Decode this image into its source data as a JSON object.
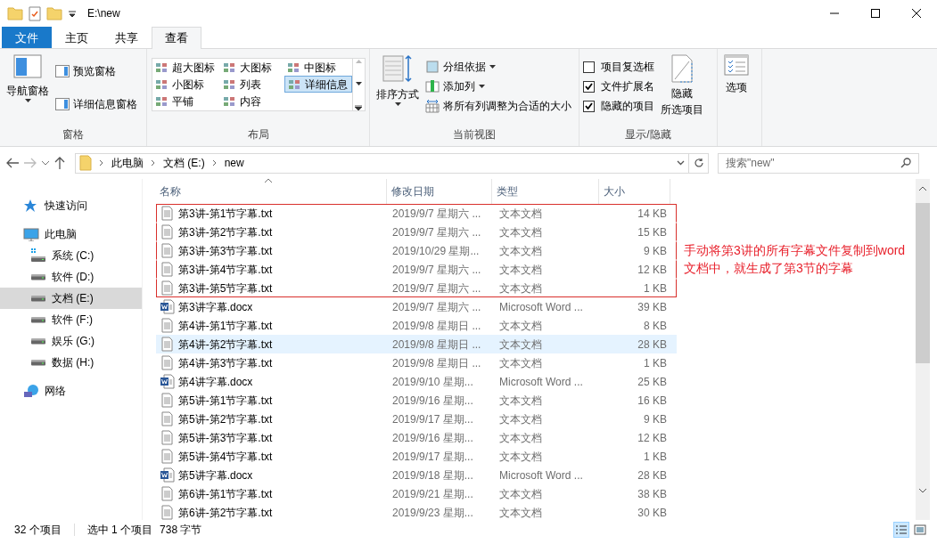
{
  "window": {
    "title": "E:\\new"
  },
  "tabs": [
    {
      "label": "文件",
      "kind": "file",
      "selected": false
    },
    {
      "label": "主页",
      "kind": "tab",
      "selected": false
    },
    {
      "label": "共享",
      "kind": "tab",
      "selected": false
    },
    {
      "label": "查看",
      "kind": "tab",
      "selected": true
    }
  ],
  "ribbon": {
    "groups": [
      {
        "kind": "panes",
        "label": "窗格",
        "large": {
          "label": "导航窗格"
        },
        "items": [
          {
            "label": "预览窗格"
          },
          {
            "label": "详细信息窗格"
          }
        ]
      },
      {
        "kind": "layout",
        "label": "布局",
        "items": [
          {
            "label": "超大图标",
            "selected": false
          },
          {
            "label": "大图标",
            "selected": false
          },
          {
            "label": "中图标",
            "selected": false
          },
          {
            "label": "小图标",
            "selected": false
          },
          {
            "label": "列表",
            "selected": false
          },
          {
            "label": "详细信息",
            "selected": true
          },
          {
            "label": "平铺",
            "selected": false
          },
          {
            "label": "内容",
            "selected": false
          }
        ]
      },
      {
        "kind": "view",
        "label": "当前视图",
        "large": {
          "label": "排序方式"
        },
        "items": [
          {
            "label": "分组依据",
            "dropdown": true
          },
          {
            "label": "添加列",
            "dropdown": true
          },
          {
            "label": "将所有列调整为合适的大小",
            "dropdown": false
          }
        ]
      },
      {
        "kind": "showhide",
        "label": "显示/隐藏",
        "checks": [
          {
            "label": "项目复选框",
            "checked": false
          },
          {
            "label": "文件扩展名",
            "checked": true
          },
          {
            "label": "隐藏的项目",
            "checked": true
          }
        ],
        "large": {
          "lines": [
            "隐藏",
            "所选项目"
          ]
        }
      },
      {
        "kind": "options",
        "large": {
          "label": "选项"
        }
      }
    ]
  },
  "address": {
    "crumbs": [
      "此电脑",
      "文档 (E:)",
      "new"
    ],
    "search_placeholder": "搜索\"new\""
  },
  "sidebar": {
    "items": [
      {
        "label": "快速访问",
        "kind": "star",
        "selected": false
      },
      {
        "label": "此电脑",
        "kind": "pc",
        "selected": false,
        "children": [
          {
            "label": "系统 (C:)",
            "kind": "sysdrive",
            "selected": false
          },
          {
            "label": "软件 (D:)",
            "kind": "drive",
            "selected": false
          },
          {
            "label": "文档 (E:)",
            "kind": "drive",
            "selected": true
          },
          {
            "label": "软件 (F:)",
            "kind": "drive",
            "selected": false
          },
          {
            "label": "娱乐 (G:)",
            "kind": "drive",
            "selected": false
          },
          {
            "label": "数据 (H:)",
            "kind": "drive",
            "selected": false
          }
        ]
      },
      {
        "label": "网络",
        "kind": "network",
        "selected": false
      }
    ]
  },
  "table": {
    "columns": [
      "名称",
      "修改日期",
      "类型",
      "大小"
    ],
    "rows": [
      {
        "name": "第3讲-第1节字幕.txt",
        "date": "2019/9/7 星期六 ...",
        "type": "文本文档",
        "size": "14 KB",
        "kind": "txt",
        "selected": false,
        "boxed": true
      },
      {
        "name": "第3讲-第2节字幕.txt",
        "date": "2019/9/7 星期六 ...",
        "type": "文本文档",
        "size": "15 KB",
        "kind": "txt",
        "selected": false,
        "boxed": true
      },
      {
        "name": "第3讲-第3节字幕.txt",
        "date": "2019/10/29 星期...",
        "type": "文本文档",
        "size": "9 KB",
        "kind": "txt",
        "selected": false,
        "boxed": true
      },
      {
        "name": "第3讲-第4节字幕.txt",
        "date": "2019/9/7 星期六 ...",
        "type": "文本文档",
        "size": "12 KB",
        "kind": "txt",
        "selected": false,
        "boxed": true
      },
      {
        "name": "第3讲-第5节字幕.txt",
        "date": "2019/9/7 星期六 ...",
        "type": "文本文档",
        "size": "1 KB",
        "kind": "txt",
        "selected": false,
        "boxed": true
      },
      {
        "name": "第3讲字幕.docx",
        "date": "2019/9/7 星期六 ...",
        "type": "Microsoft Word ...",
        "size": "39 KB",
        "kind": "docx",
        "selected": false,
        "boxed": false
      },
      {
        "name": "第4讲-第1节字幕.txt",
        "date": "2019/9/8 星期日 ...",
        "type": "文本文档",
        "size": "8 KB",
        "kind": "txt",
        "selected": false,
        "boxed": false
      },
      {
        "name": "第4讲-第2节字幕.txt",
        "date": "2019/9/8 星期日 ...",
        "type": "文本文档",
        "size": "28 KB",
        "kind": "txt",
        "selected": true,
        "boxed": false
      },
      {
        "name": "第4讲-第3节字幕.txt",
        "date": "2019/9/8 星期日 ...",
        "type": "文本文档",
        "size": "1 KB",
        "kind": "txt",
        "selected": false,
        "boxed": false
      },
      {
        "name": "第4讲字幕.docx",
        "date": "2019/9/10 星期...",
        "type": "Microsoft Word ...",
        "size": "25 KB",
        "kind": "docx",
        "selected": false,
        "boxed": false
      },
      {
        "name": "第5讲-第1节字幕.txt",
        "date": "2019/9/16 星期...",
        "type": "文本文档",
        "size": "16 KB",
        "kind": "txt",
        "selected": false,
        "boxed": false
      },
      {
        "name": "第5讲-第2节字幕.txt",
        "date": "2019/9/17 星期...",
        "type": "文本文档",
        "size": "9 KB",
        "kind": "txt",
        "selected": false,
        "boxed": false
      },
      {
        "name": "第5讲-第3节字幕.txt",
        "date": "2019/9/16 星期...",
        "type": "文本文档",
        "size": "12 KB",
        "kind": "txt",
        "selected": false,
        "boxed": false
      },
      {
        "name": "第5讲-第4节字幕.txt",
        "date": "2019/9/17 星期...",
        "type": "文本文档",
        "size": "1 KB",
        "kind": "txt",
        "selected": false,
        "boxed": false
      },
      {
        "name": "第5讲字幕.docx",
        "date": "2019/9/18 星期...",
        "type": "Microsoft Word ...",
        "size": "28 KB",
        "kind": "docx",
        "selected": false,
        "boxed": false
      },
      {
        "name": "第6讲-第1节字幕.txt",
        "date": "2019/9/21 星期...",
        "type": "文本文档",
        "size": "38 KB",
        "kind": "txt",
        "selected": false,
        "boxed": false
      },
      {
        "name": "第6讲-第2节字幕.txt",
        "date": "2019/9/23 星期...",
        "type": "文本文档",
        "size": "30 KB",
        "kind": "txt",
        "selected": false,
        "boxed": false
      }
    ]
  },
  "annotation": {
    "text": "手动将第3讲的所有字幕文件复制到word文档中，就生成了第3节的字幕"
  },
  "status_bar": {
    "count": "32 个项目",
    "selection": "选中 1 个项目",
    "size": "738 字节",
    "views": [
      {
        "kind": "details",
        "selected": true
      },
      {
        "kind": "large",
        "selected": false
      }
    ]
  }
}
